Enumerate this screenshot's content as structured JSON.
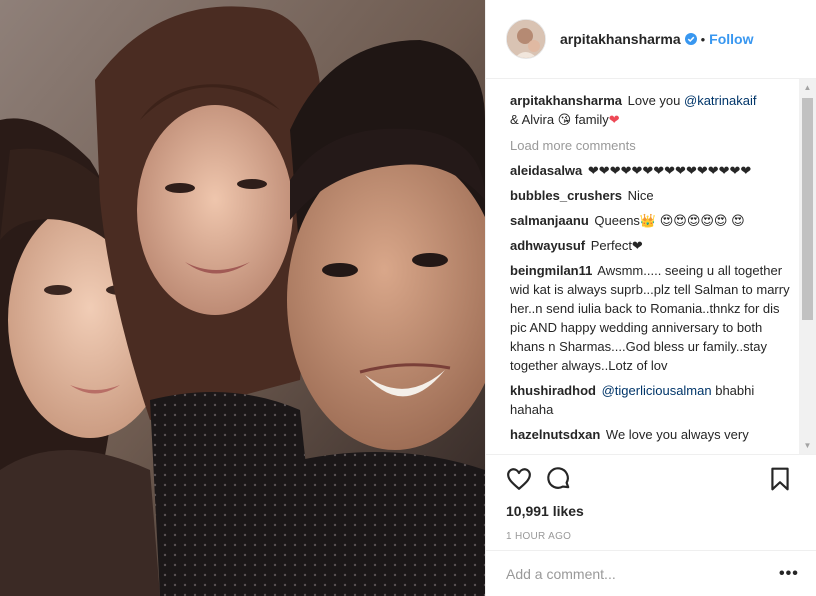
{
  "post": {
    "username": "arpitakhansharma",
    "follow_label": "Follow",
    "dot": "•",
    "caption_user": "arpitakhansharma",
    "caption_parts": [
      "Love you ",
      "@katrinakaif",
      " & Alvira 😘 family",
      "❤"
    ],
    "load_more": "Load more comments",
    "comments": [
      {
        "user": "aleidasalwa",
        "text": "❤❤❤❤❤❤❤❤❤❤❤❤❤❤❤"
      },
      {
        "user": "bubbles_crushers",
        "text": "Nice"
      },
      {
        "user": "salmanjaanu",
        "text": "Queens👑 😍😍😍😍😍 😍"
      },
      {
        "user": "adhwayusuf",
        "text": "Perfect❤"
      },
      {
        "user": "beingmilan11",
        "text": "Awsmm..... seeing u all together wid kat is always suprb...plz tell Salman to marry her..n send iulia back to Romania..thnkz for dis pic AND happy wedding anniversary to both khans n Sharmas....God bless ur family..stay together always..Lotz of lov"
      },
      {
        "user": "khushiradhod",
        "mention": "@tigerliciousalman",
        "text": " bhabhi hahaha"
      },
      {
        "user": "hazelnutsdxan",
        "text": "We love you always very"
      }
    ],
    "likes": "10,991 likes",
    "time": "1 HOUR AGO",
    "add_comment_placeholder": "Add a comment...",
    "more_label": "•••"
  },
  "icons": {
    "like": "heart-icon",
    "comment": "comment-icon",
    "save": "bookmark-icon",
    "verified": "verified-badge-icon"
  },
  "colors": {
    "accent": "#3897f0",
    "text": "#262626",
    "muted": "#999999",
    "mention": "#003569",
    "border": "#efefef"
  }
}
